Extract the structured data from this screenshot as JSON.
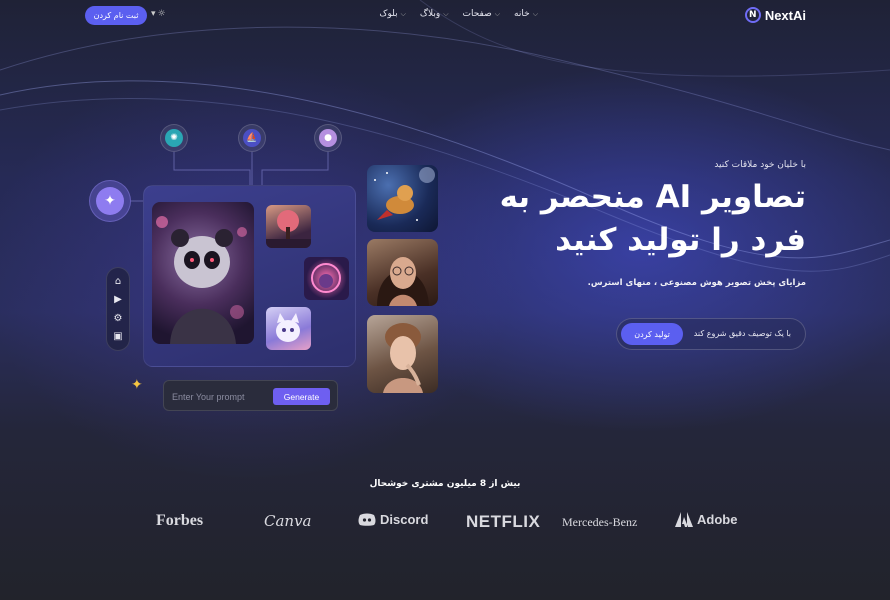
{
  "header": {
    "logo_text": "NextAi",
    "logo_mark": "N",
    "nav": [
      {
        "label": "خانه"
      },
      {
        "label": "صفحات"
      },
      {
        "label": "وبلاگ"
      },
      {
        "label": "بلوک"
      }
    ],
    "signup_label": "ثبت نام کردن",
    "theme_icon": "sun-icon"
  },
  "hero": {
    "eyebrow": "با خلیان خود ملاقات کنید",
    "headline": "تصاویر AI منحصر به فرد را تولید کنید",
    "subtext": "مزایای پخش تصویر هوش مصنوعی ، منهای استرس.",
    "cta_hint": "با یک توصیف دقیق شروع کند",
    "cta_label": "تولید کردن"
  },
  "generator": {
    "prompt_placeholder": "Enter Your prompt",
    "generate_label": "Generate",
    "tools": [
      "home-icon",
      "play-icon",
      "settings-icon",
      "image-icon"
    ],
    "floating_icons": [
      "openai-icon",
      "midjourney-icon",
      "avatar-icon",
      "sparkle-icon"
    ]
  },
  "brands": {
    "title": "بیش از 8 میلیون مشتری خوشحال",
    "items": [
      {
        "name": "Forbes"
      },
      {
        "name": "Canva"
      },
      {
        "name": "Discord"
      },
      {
        "name": "NETFLIX"
      },
      {
        "name": "Mercedes-Benz"
      },
      {
        "name": "Adobe"
      }
    ]
  },
  "colors": {
    "accent": "#5b5ff0",
    "background": "#23242e",
    "hero_glow": "#3a3fb0"
  }
}
